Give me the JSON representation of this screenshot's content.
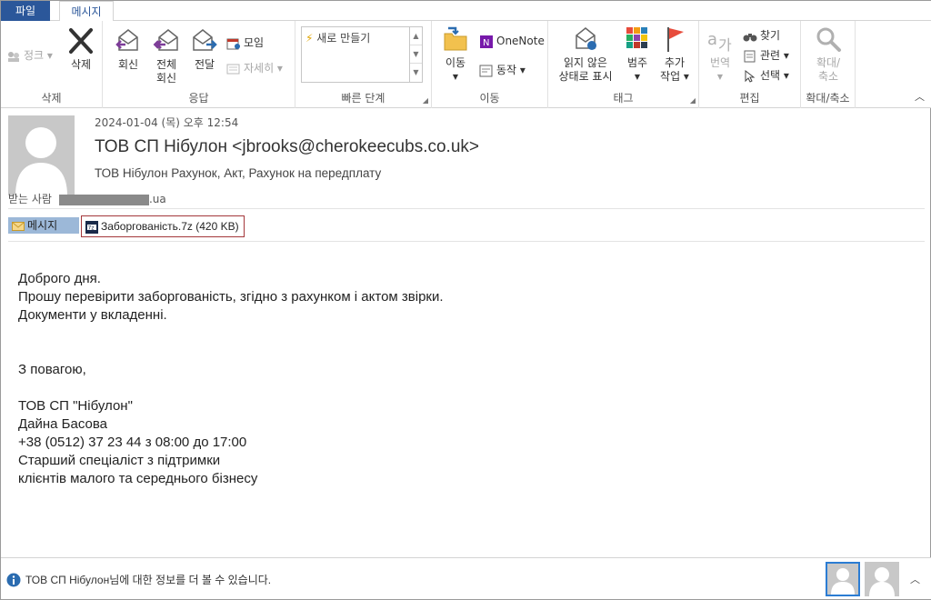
{
  "tabs": {
    "file": "파일",
    "message": "메시지"
  },
  "ribbon": {
    "delete_group": {
      "label": "삭제",
      "cleanup": "정크 ▾",
      "delete": "삭제"
    },
    "respond_group": {
      "label": "응답",
      "reply": "회신",
      "reply_all_1": "전체",
      "reply_all_2": "회신",
      "forward": "전달",
      "meeting": "모임",
      "more": "자세히 ▾"
    },
    "quick_steps": {
      "label": "빠른 단계",
      "item": "새로 만들기"
    },
    "move_group": {
      "label": "이동",
      "move": "이동",
      "onenote": "OneNote",
      "actions": "동작 ▾"
    },
    "tags_group": {
      "label": "태그",
      "unread_1": "읽지 않은",
      "unread_2": "상태로 표시",
      "categorize": "범주",
      "followup_1": "추가",
      "followup_2": "작업 ▾"
    },
    "editing_group": {
      "label": "편집",
      "translate": "번역",
      "find": "찾기",
      "related": "관련 ▾",
      "select": "선택 ▾"
    },
    "zoom_group": {
      "label": "확대/축소",
      "zoom_1": "확대/",
      "zoom_2": "축소"
    }
  },
  "header": {
    "date": "2024-01-04 (목) 오후 12:54",
    "sender": "ТОВ СП Нібулон <jbrooks@cherokeecubs.co.uk>",
    "subject": "ТОВ Нібулон Рахунок, Акт, Рахунок на передплату",
    "to_label": "받는 사람",
    "to_domain": ".ua",
    "message_tab": "메시지",
    "attachment": "Заборгованість.7z (420 KB)"
  },
  "body": {
    "lines": [
      "Доброго дня.",
      "Прошу перевірити заборгованість, згідно з рахунком і актом звірки.",
      "Документи у вкладенні.",
      "",
      "",
      "З повагою,",
      "",
      "ТОВ СП \"Нібулон\"",
      "Дайна Басова",
      "+38 (0512) 37 23 44 з 08:00 до 17:00",
      "Старший спеціаліст з підтримки",
      "клієнтів малого та середнього бізнесу"
    ]
  },
  "footer": {
    "people_text": "ТОВ СП Нібулон님에 대한 정보를 더 볼 수 있습니다."
  },
  "colors": {
    "accent": "#2b579a",
    "attachment_border": "#a4373a",
    "message_tab": "#9cb8d8"
  }
}
